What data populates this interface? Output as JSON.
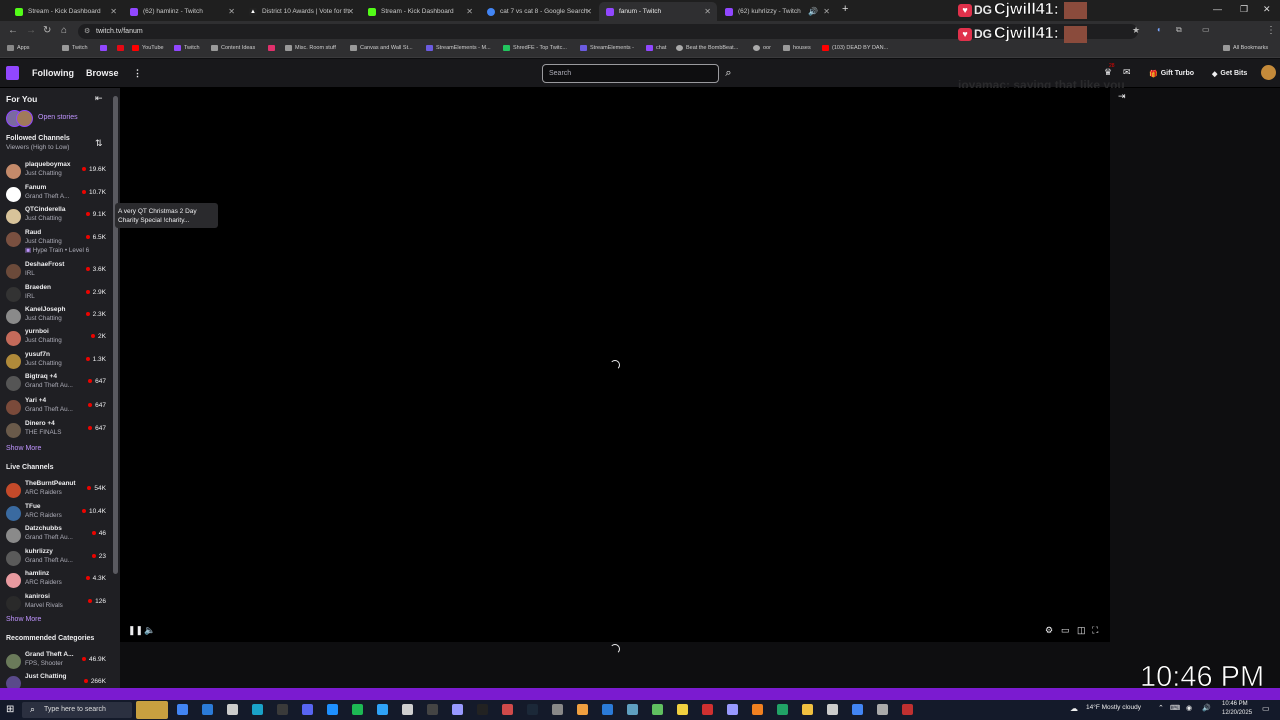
{
  "browser": {
    "tabs": [
      {
        "label": "Stream - Kick Dashboard",
        "color": "#53fc18",
        "active": false
      },
      {
        "label": "(62) hamlinz - Twitch",
        "color": "#9147ff",
        "active": false
      },
      {
        "label": "District 10 Awards | Vote for th",
        "color": "#222222",
        "active": false
      },
      {
        "label": "Stream - Kick Dashboard",
        "color": "#53fc18",
        "active": false
      },
      {
        "label": "cat 7 vs cat 8 - Google Search",
        "color": "#4285f4",
        "active": false
      },
      {
        "label": "fanum - Twitch",
        "color": "#9147ff",
        "active": true
      },
      {
        "label": "(62) kuhrlizzy - Twitch",
        "color": "#9147ff",
        "active": false
      }
    ],
    "new_tab": "+",
    "url": "twitch.tv/fanum",
    "bookmarks": [
      {
        "label": "Apps",
        "color": "#888888"
      },
      {
        "label": "Twitch",
        "color": "#9147ff"
      },
      {
        "label": "",
        "color": "#9147ff"
      },
      {
        "label": "YouTube",
        "color": "#ff0000"
      },
      {
        "label": "Twitch",
        "color": "#9147ff"
      },
      {
        "label": "Content Ideas",
        "color": "#999999"
      },
      {
        "label": "",
        "color": "#e1306c"
      },
      {
        "label": "Misc. Room stuff",
        "color": "#999999"
      },
      {
        "label": "Canvas and Wall St...",
        "color": "#999999"
      },
      {
        "label": "StreamElements - M...",
        "color": "#6b5be0"
      },
      {
        "label": "ShredFE - Top Twitc...",
        "color": "#22c55e"
      },
      {
        "label": "StreamElements -",
        "color": "#6b5be0"
      },
      {
        "label": "chat",
        "color": "#9147ff"
      },
      {
        "label": "Beat the BombBeat...",
        "color": "#aaaaaa"
      },
      {
        "label": "oor",
        "color": "#aaaaaa"
      },
      {
        "label": "houses",
        "color": "#999999"
      },
      {
        "label": "(103) DEAD BY DAN...",
        "color": "#ff0000"
      }
    ],
    "all_bookmarks": "All Bookmarks"
  },
  "overlay": {
    "alert_prefix": "DG",
    "alert_name": "Cjwill41:",
    "chat_ghost": "joyamac: saying that like you"
  },
  "twitch": {
    "nav": {
      "following": "Following",
      "browse": "Browse",
      "more": "⋮",
      "search_placeholder": "Search",
      "badge_count": "28",
      "gift_turbo": "Gift Turbo",
      "get_bits": "Get Bits"
    },
    "sidebar": {
      "for_you": "For You",
      "open_stories": "Open stories",
      "followed_title": "Followed Channels",
      "followed_sort": "Viewers (High to Low)",
      "followed": [
        {
          "name": "plaqueboymax",
          "game": "Just Chatting",
          "viewers": "19.6K",
          "color": "#c48a6a"
        },
        {
          "name": "Fanum",
          "game": "Grand Theft A...",
          "viewers": "10.7K",
          "color": "#ffffff"
        },
        {
          "name": "QTCinderella",
          "game": "Just Chatting",
          "viewers": "9.1K",
          "color": "#d8c39a"
        },
        {
          "name": "Raud",
          "game": "Just Chatting",
          "viewers": "6.5K",
          "color": "#7a5040"
        },
        {
          "name": "DeshaeFrost",
          "game": "IRL",
          "viewers": "3.6K",
          "color": "#6b4a3a"
        },
        {
          "name": "Braeden",
          "game": "IRL",
          "viewers": "2.9K",
          "color": "#333333"
        },
        {
          "name": "KaneIJoseph",
          "game": "Just Chatting",
          "viewers": "2.3K",
          "color": "#8a8a8a"
        },
        {
          "name": "yurnboi",
          "game": "Just Chatting",
          "viewers": "2K",
          "color": "#c46a5a"
        },
        {
          "name": "yusuf7n",
          "game": "Just Chatting",
          "viewers": "1.3K",
          "color": "#b08a3a"
        },
        {
          "name": "Bigtraq +4",
          "game": "Grand Theft Au...",
          "viewers": "647",
          "color": "#555555"
        },
        {
          "name": "Yari +4",
          "game": "Grand Theft Au...",
          "viewers": "647",
          "color": "#7a4a3a"
        },
        {
          "name": "Dinero +4",
          "game": "THE FINALS",
          "viewers": "647",
          "color": "#6a5a4a"
        }
      ],
      "hype_train": "Hype Train • Level 6",
      "show_more_1": "Show More",
      "live_title": "Live Channels",
      "live": [
        {
          "name": "TheBurntPeanut",
          "game": "ARC Raiders",
          "viewers": "54K",
          "color": "#c44a2a"
        },
        {
          "name": "TFue",
          "game": "ARC Raiders",
          "viewers": "10.4K",
          "color": "#3a6aa0"
        },
        {
          "name": "Datzchubbs",
          "game": "Grand Theft Au...",
          "viewers": "46",
          "color": "#8a8a8a"
        },
        {
          "name": "kuhrlizzy",
          "game": "Grand Theft Au...",
          "viewers": "23",
          "color": "#5a5a5a"
        },
        {
          "name": "hamlinz",
          "game": "ARC Raiders",
          "viewers": "4.3K",
          "color": "#e89aa0"
        },
        {
          "name": "kanirosi",
          "game": "Marvel Rivals",
          "viewers": "126",
          "color": "#2a2a2a"
        }
      ],
      "show_more_2": "Show More",
      "rec_title": "Recommended Categories",
      "recommended": [
        {
          "name": "Grand Theft A...",
          "game": "FPS, Shooter",
          "viewers": "46.9K",
          "color": "#6a7a5a"
        },
        {
          "name": "Just Chatting",
          "game": "",
          "viewers": "266K",
          "color": "#5a4a8a"
        }
      ]
    },
    "tooltip": "A very QT Christmas 2 Day Charity Special !charity..."
  },
  "taskbar": {
    "search_placeholder": "Type here to search",
    "weather": "14°F  Mostly cloudy",
    "time": "10:46 PM",
    "date": "12/20/2025",
    "big_clock": "10:46 PM"
  }
}
